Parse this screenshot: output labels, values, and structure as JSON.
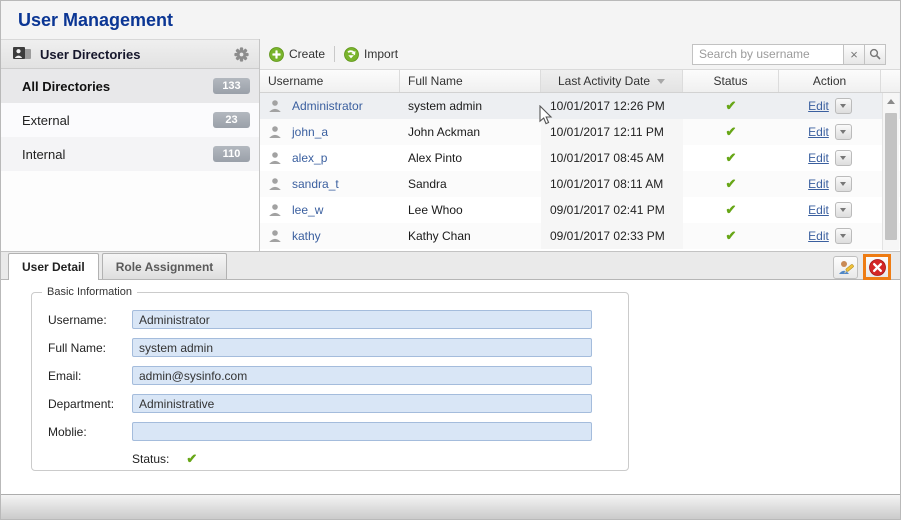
{
  "page": {
    "title": "User Management"
  },
  "sidebar": {
    "title": "User Directories",
    "items": [
      {
        "label": "All Directories",
        "count": "133",
        "selected": true
      },
      {
        "label": "External",
        "count": "23",
        "selected": false
      },
      {
        "label": "Internal",
        "count": "110",
        "selected": false
      }
    ]
  },
  "toolbar": {
    "create_label": "Create",
    "import_label": "Import",
    "search": {
      "placeholder": "Search by username",
      "value": ""
    }
  },
  "table": {
    "columns": {
      "username": "Username",
      "full_name": "Full Name",
      "last_activity": "Last Activity Date",
      "status": "Status",
      "action": "Action"
    },
    "sort": {
      "column": "Last Activity Date",
      "direction": "desc"
    },
    "action_edit_label": "Edit",
    "rows": [
      {
        "username": "Administrator",
        "full_name": "system admin",
        "last_activity": "10/01/2017 12:26 PM",
        "status": "active",
        "selected": true
      },
      {
        "username": "john_a",
        "full_name": "John Ackman",
        "last_activity": "10/01/2017 12:11 PM",
        "status": "active",
        "selected": false
      },
      {
        "username": "alex_p",
        "full_name": "Alex Pinto",
        "last_activity": "10/01/2017 08:45 AM",
        "status": "active",
        "selected": false
      },
      {
        "username": "sandra_t",
        "full_name": "Sandra",
        "last_activity": "10/01/2017 08:11 AM",
        "status": "active",
        "selected": false
      },
      {
        "username": "lee_w",
        "full_name": "Lee Whoo",
        "last_activity": "09/01/2017 02:41 PM",
        "status": "active",
        "selected": false
      },
      {
        "username": "kathy",
        "full_name": "Kathy Chan",
        "last_activity": "09/01/2017 02:33 PM",
        "status": "active",
        "selected": false
      }
    ]
  },
  "detail_panel": {
    "tabs": [
      {
        "label": "User Detail",
        "active": true
      },
      {
        "label": "Role Assignment",
        "active": false
      }
    ],
    "legend": "Basic Information",
    "fields": [
      {
        "label": "Username:",
        "value": "Administrator"
      },
      {
        "label": "Full Name:",
        "value": "system admin"
      },
      {
        "label": "Email:",
        "value": "admin@sysinfo.com"
      },
      {
        "label": "Department:",
        "value": "Administrative"
      },
      {
        "label": "Moblie:",
        "value": ""
      }
    ],
    "status_label": "Status:",
    "status": "active"
  },
  "colors": {
    "title_blue": "#0b3694",
    "link_blue": "#3a5f9f",
    "status_green": "#67a617",
    "badge_gray": "#9aa0a9",
    "selected_row": "#edeff2",
    "highlight_orange": "#ee7c14",
    "close_red": "#d42626",
    "input_blue_bg": "#d9e6f6",
    "input_blue_border": "#a4bcdc"
  }
}
